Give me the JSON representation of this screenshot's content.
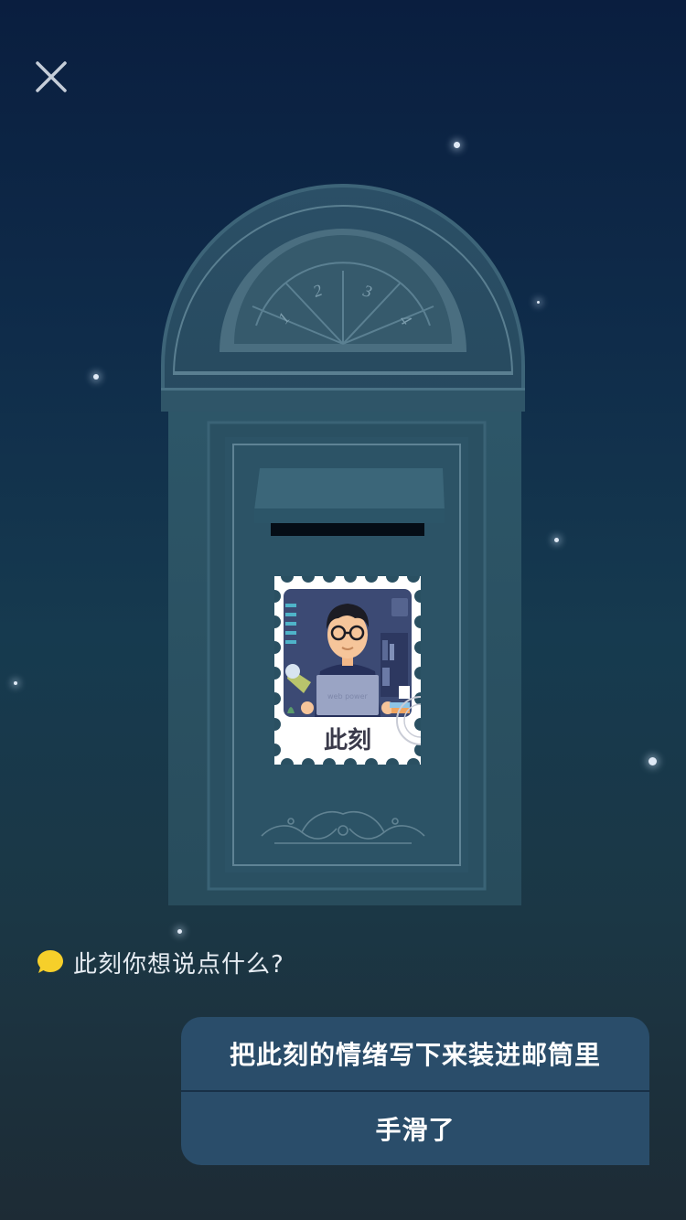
{
  "header": {
    "close_icon": "close-icon"
  },
  "mailbox": {
    "dial_numbers": [
      "1",
      "2",
      "3",
      "4"
    ],
    "stamp_label": "此刻"
  },
  "prompt": {
    "icon": "speech-bubble-icon",
    "text": "此刻你想说点什么?"
  },
  "actions": {
    "write_label": "把此刻的情绪写下来装进邮筒里",
    "cancel_label": "手滑了"
  },
  "colors": {
    "bubble_yellow": "#f6cf2a",
    "panel": "#2a4d6a",
    "mailbox": "#2e5566"
  }
}
